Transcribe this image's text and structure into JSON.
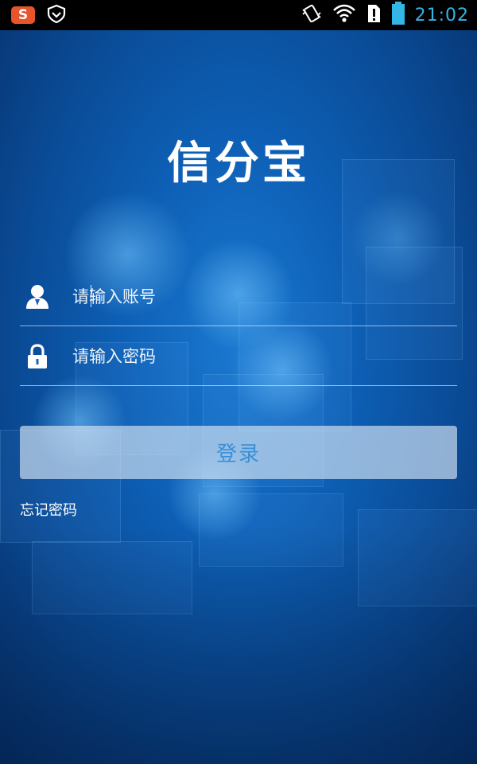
{
  "status_bar": {
    "time": "21:02",
    "left_icons": [
      "sogou-input-icon",
      "shield-icon"
    ],
    "right_icons": [
      "vibrate-icon",
      "wifi-icon",
      "sim-alert-icon",
      "battery-icon"
    ],
    "time_color": "#33b5e5"
  },
  "app": {
    "title": "信分宝"
  },
  "login_form": {
    "account": {
      "placeholder": "请输入账号",
      "value": "",
      "icon": "user-icon"
    },
    "password": {
      "placeholder": "请输入密码",
      "value": "",
      "icon": "lock-icon"
    },
    "login_label": "登录",
    "forgot_password_label": "忘记密码"
  },
  "colors": {
    "background_primary": "#0d5fb5",
    "button_text": "#3a8fd6",
    "text": "#ffffff"
  }
}
